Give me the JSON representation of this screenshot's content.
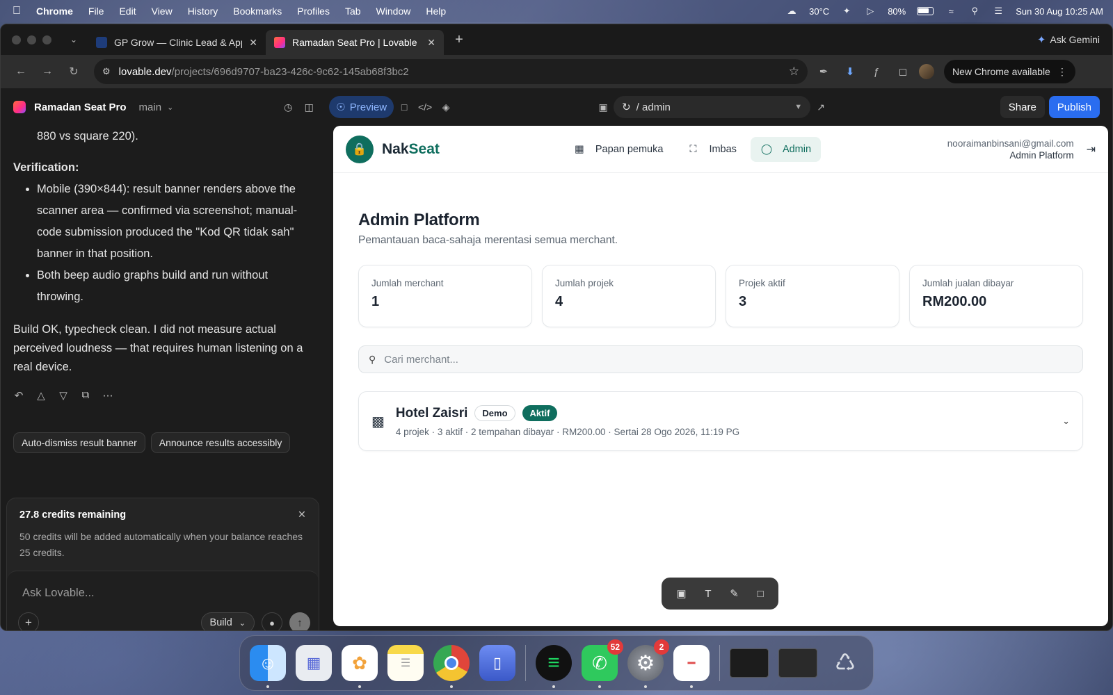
{
  "menubar": {
    "app": "Chrome",
    "items": [
      "File",
      "Edit",
      "View",
      "History",
      "Bookmarks",
      "Profiles",
      "Tab",
      "Window",
      "Help"
    ],
    "weather": "30°C",
    "battery": "80%",
    "datetime": "Sun 30 Aug  10:25 AM"
  },
  "browser": {
    "tabs": [
      {
        "title": "GP Grow — Clinic Lead & App",
        "favicon_color": "#3b6fd8"
      },
      {
        "title": "Ramadan Seat Pro | Lovable",
        "favicon_color": "#ff4d6d"
      }
    ],
    "ask_gemini": "Ask Gemini",
    "url_host": "lovable.dev",
    "url_path": "/projects/696d9707-ba23-426c-9c62-145ab68f3bc2",
    "new_chrome": "New Chrome available"
  },
  "lovable": {
    "project_name": "Ramadan Seat Pro",
    "branch": "main",
    "preview_label": "Preview",
    "route": "/ admin",
    "share": "Share",
    "publish": "Publish"
  },
  "chat": {
    "line_top": "880 vs square 220).",
    "verification_heading": "Verification:",
    "bullets": [
      "Mobile (390×844): result banner renders above the scanner area — confirmed via screenshot; manual-code submission produced the \"Kod QR tidak sah\" banner in that position.",
      "Both beep audio graphs build and run without throwing."
    ],
    "summary": "Build OK, typecheck clean. I did not measure actual perceived loudness — that requires human listening on a real device.",
    "suggestions": [
      "Auto-dismiss result banner",
      "Announce results accessibly"
    ],
    "credits_title": "27.8 credits remaining",
    "credits_text": "50 credits will be added automatically when your balance reaches 25 credits.",
    "input_placeholder": "Ask Lovable...",
    "mode": "Build"
  },
  "preview": {
    "brand_nak": "Nak",
    "brand_seat": "Seat",
    "nav": [
      "Papan pemuka",
      "Imbas",
      "Admin"
    ],
    "user_email": "nooraimanbinsani@gmail.com",
    "user_role": "Admin Platform",
    "page_title": "Admin Platform",
    "page_subtitle": "Pemantauan baca-sahaja merentasi semua merchant.",
    "stats": [
      {
        "label": "Jumlah merchant",
        "value": "1"
      },
      {
        "label": "Jumlah projek",
        "value": "4"
      },
      {
        "label": "Projek aktif",
        "value": "3"
      },
      {
        "label": "Jumlah jualan dibayar",
        "value": "RM200.00"
      }
    ],
    "search_placeholder": "Cari merchant...",
    "merchant": {
      "name": "Hotel Zaisri",
      "badge_demo": "Demo",
      "badge_status": "Aktif",
      "meta": "4 projek · 3 aktif · 2 tempahan dibayar · RM200.00 · Sertai 28 Ogo 2026, 11:19 PG"
    }
  },
  "dock": {
    "whatsapp_badge": "52",
    "settings_badge": "2"
  },
  "colors": {
    "accent_teal": "#0f6e5e",
    "publish_blue": "#2a6df0",
    "preview_blue": "#1e3a6d"
  }
}
